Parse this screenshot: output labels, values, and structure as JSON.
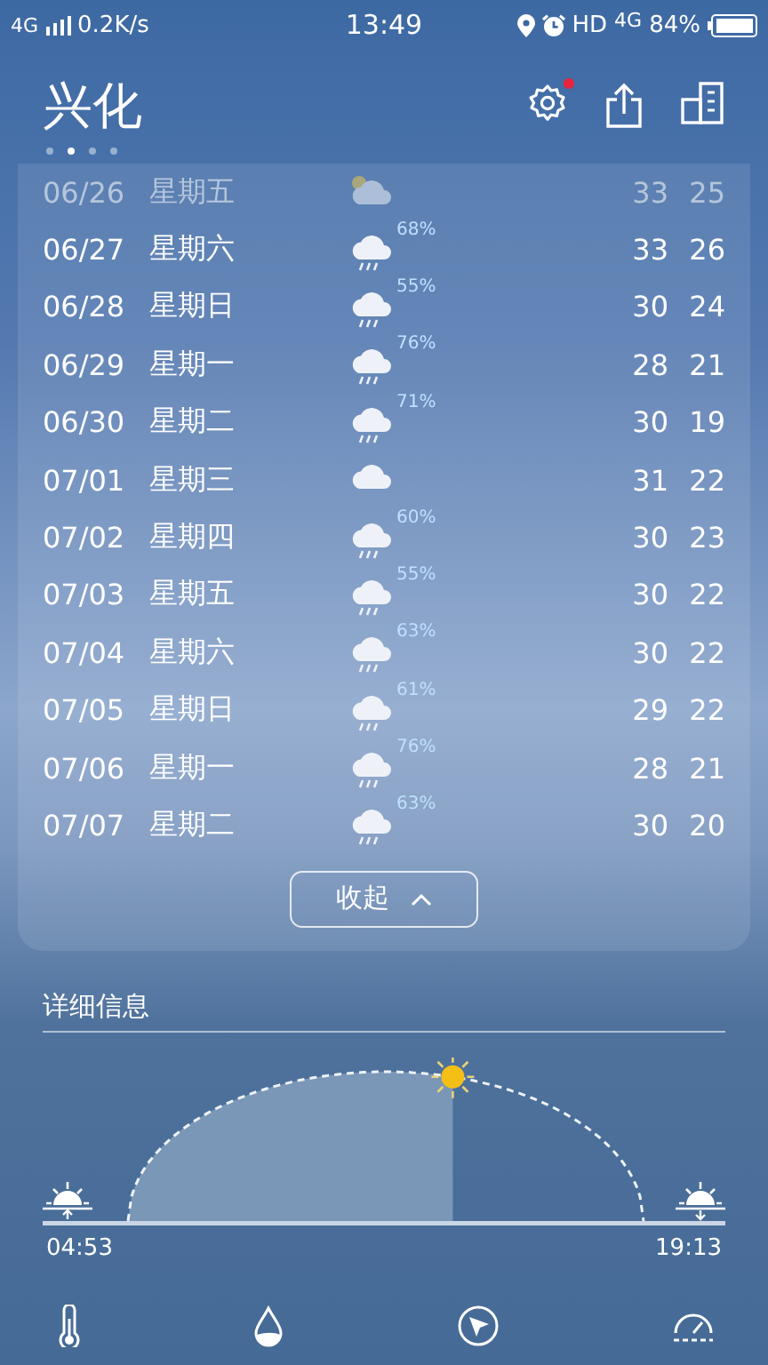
{
  "status_bar": {
    "network": "4G",
    "speed": "0.2K/s",
    "time": "13:49",
    "hd": "HD",
    "network_right": "4G",
    "battery": "84%"
  },
  "header": {
    "city": "兴化",
    "settings_badge": true,
    "pages": [
      {
        "selected": false
      },
      {
        "selected": true
      },
      {
        "selected": false
      },
      {
        "selected": false
      }
    ]
  },
  "forecast": [
    {
      "date": "06/26",
      "weekday": "星期五",
      "kind": "partly_cloudy",
      "faded": true,
      "high": "33",
      "low": "25"
    },
    {
      "date": "06/27",
      "weekday": "星期六",
      "kind": "rain",
      "faded": false,
      "precip": "68%",
      "high": "33",
      "low": "26"
    },
    {
      "date": "06/28",
      "weekday": "星期日",
      "kind": "rain",
      "faded": false,
      "precip": "55%",
      "high": "30",
      "low": "24"
    },
    {
      "date": "06/29",
      "weekday": "星期一",
      "kind": "rain",
      "faded": false,
      "precip": "76%",
      "high": "28",
      "low": "21"
    },
    {
      "date": "06/30",
      "weekday": "星期二",
      "kind": "rain",
      "faded": false,
      "precip": "71%",
      "high": "30",
      "low": "19"
    },
    {
      "date": "07/01",
      "weekday": "星期三",
      "kind": "cloudy",
      "faded": false,
      "high": "31",
      "low": "22"
    },
    {
      "date": "07/02",
      "weekday": "星期四",
      "kind": "rain",
      "faded": false,
      "precip": "60%",
      "high": "30",
      "low": "23"
    },
    {
      "date": "07/03",
      "weekday": "星期五",
      "kind": "rain",
      "faded": false,
      "precip": "55%",
      "high": "30",
      "low": "22"
    },
    {
      "date": "07/04",
      "weekday": "星期六",
      "kind": "rain",
      "faded": false,
      "precip": "63%",
      "high": "30",
      "low": "22"
    },
    {
      "date": "07/05",
      "weekday": "星期日",
      "kind": "rain",
      "faded": false,
      "precip": "61%",
      "high": "29",
      "low": "22"
    },
    {
      "date": "07/06",
      "weekday": "星期一",
      "kind": "rain",
      "faded": false,
      "precip": "76%",
      "high": "28",
      "low": "21"
    },
    {
      "date": "07/07",
      "weekday": "星期二",
      "kind": "rain",
      "faded": false,
      "precip": "63%",
      "high": "30",
      "low": "20"
    }
  ],
  "collapse_button": "收起",
  "details": {
    "title": "详细信息",
    "sun": {
      "level": 0.63,
      "sunrise": "04:53",
      "sunset": "19:13"
    }
  }
}
